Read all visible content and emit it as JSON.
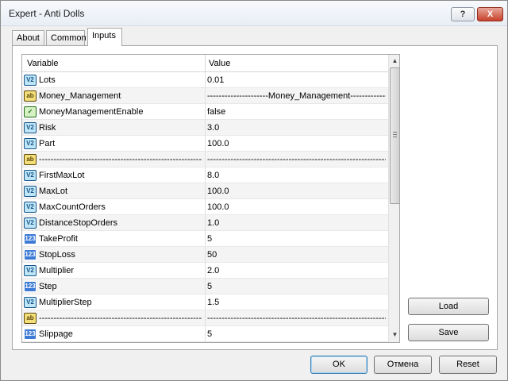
{
  "window": {
    "title": "Expert - Anti Dolls",
    "help_label": "?",
    "close_label": "X"
  },
  "tabs": [
    {
      "label": "About"
    },
    {
      "label": "Common"
    },
    {
      "label": "Inputs"
    }
  ],
  "grid": {
    "col_variable": "Variable",
    "col_value": "Value",
    "rows": [
      {
        "icon": "V2",
        "type": "double",
        "name": "Lots",
        "value": "0.01"
      },
      {
        "icon": "ab",
        "type": "string",
        "name": "Money_Management",
        "value": "---------------------Money_Management--------------..."
      },
      {
        "icon": "✓",
        "type": "bool",
        "name": "MoneyManagementEnable",
        "value": "false"
      },
      {
        "icon": "V2",
        "type": "double",
        "name": "Risk",
        "value": "3.0"
      },
      {
        "icon": "V2",
        "type": "double",
        "name": "Part",
        "value": "100.0"
      },
      {
        "icon": "ab",
        "type": "string",
        "name": "-----------------------------------------------------------",
        "value": "----------------------------------------------------------------..."
      },
      {
        "icon": "V2",
        "type": "double",
        "name": "FirstMaxLot",
        "value": "8.0"
      },
      {
        "icon": "V2",
        "type": "double",
        "name": "MaxLot",
        "value": "100.0"
      },
      {
        "icon": "V2",
        "type": "double",
        "name": "MaxCountOrders",
        "value": "100.0"
      },
      {
        "icon": "V2",
        "type": "double",
        "name": "DistanceStopOrders",
        "value": "1.0"
      },
      {
        "icon": "123",
        "type": "int",
        "name": "TakeProfit",
        "value": "5"
      },
      {
        "icon": "123",
        "type": "int",
        "name": "StopLoss",
        "value": "50"
      },
      {
        "icon": "V2",
        "type": "double",
        "name": "Multiplier",
        "value": "2.0"
      },
      {
        "icon": "123",
        "type": "int",
        "name": "Step",
        "value": "5"
      },
      {
        "icon": "V2",
        "type": "double",
        "name": "MultiplierStep",
        "value": "1.5"
      },
      {
        "icon": "ab",
        "type": "string",
        "name": "-----------------------------------------------------------",
        "value": "----------------------------------------------------------------..."
      },
      {
        "icon": "123",
        "type": "int",
        "name": "Slippage",
        "value": "5"
      }
    ]
  },
  "side_buttons": {
    "load_label": "Load",
    "save_label": "Save"
  },
  "footer": {
    "ok_label": "OK",
    "cancel_label": "Отмена",
    "reset_label": "Reset"
  },
  "icons": {
    "scroll_up": "▲",
    "scroll_down": "▼"
  }
}
